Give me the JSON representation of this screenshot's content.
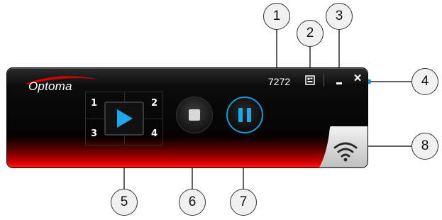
{
  "window": {
    "brand": "Optoma",
    "login_code": "7272",
    "buttons": {
      "qr_code": "qr-code-icon",
      "minimize": "minimize-icon",
      "close": "×"
    }
  },
  "split_screen": {
    "quadrants": [
      "1",
      "2",
      "3",
      "4"
    ],
    "play_icon": "play-icon"
  },
  "controls": {
    "stop_icon": "stop-icon",
    "pause_icon": "pause-icon",
    "wifi_icon": "wifi-icon"
  },
  "callouts": [
    "1",
    "2",
    "3",
    "4",
    "5",
    "6",
    "7",
    "8"
  ],
  "colors": {
    "accent_blue": "#1fa8ea",
    "bar_red": "#d40000",
    "bar_black": "#050505"
  }
}
